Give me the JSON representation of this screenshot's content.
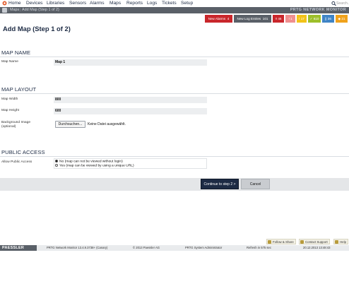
{
  "nav": {
    "items": [
      "Home",
      "Devices",
      "Libraries",
      "Sensors",
      "Alarms",
      "Maps",
      "Reports",
      "Logs",
      "Tickets",
      "Setup"
    ],
    "search_placeholder": "Search..."
  },
  "breadcrumb": {
    "items": [
      "Maps",
      "Add Map (Step 1 of 2)"
    ],
    "brand": "PRTG NETWORK MONITOR"
  },
  "badges": [
    {
      "label": "New Alarms",
      "count": "4",
      "color": "#c9262b"
    },
    {
      "label": "New Log Entries",
      "count": "101",
      "color": "#5a6068"
    },
    {
      "label": "46",
      "color": "#c9262b",
      "icon": "error-icon"
    },
    {
      "label": "1",
      "color": "#ef8f8f",
      "icon": "warning-icon"
    },
    {
      "label": "17",
      "color": "#f2c318",
      "icon": "warning-icon"
    },
    {
      "label": "610",
      "color": "#9dbf2a",
      "icon": "ok-icon"
    },
    {
      "label": "36",
      "color": "#3f84c6",
      "icon": "paused-icon"
    },
    {
      "label": "21",
      "color": "#f0a21c",
      "icon": "unusual-icon"
    }
  ],
  "page": {
    "title": "Add Map (Step 1 of 2)"
  },
  "sections": {
    "map_name": {
      "title": "MAP NAME",
      "label": "Map Name",
      "value": "Map 1"
    },
    "map_layout": {
      "title": "MAP LAYOUT",
      "width_label": "Map Width",
      "width_value": "800",
      "height_label": "Map Height",
      "height_value": "600",
      "bg_label_1": "Background Image",
      "bg_label_2": "(optional)",
      "browse_label": "Durchsuchen...",
      "no_file_label": "Keine Datei ausgewählt."
    },
    "public_access": {
      "title": "PUBLIC ACCESS",
      "label": "Allow Public Access",
      "options": [
        {
          "label": "No (map can not be viewed without login)",
          "selected": true
        },
        {
          "label": "Yes (map can be viewed by using a unique URL)",
          "selected": false
        }
      ]
    }
  },
  "actions": {
    "continue_label": "Continue to step 2 >",
    "cancel_label": "Cancel"
  },
  "help_links": [
    {
      "label": "Follow & Share"
    },
    {
      "label": "Contact Support"
    },
    {
      "label": "Help"
    }
  ],
  "footer": {
    "logo": "PAESSLER",
    "version": "PRTG Network Monitor 13.4.9.3738+ (Canary)",
    "copyright": "© 2013 Paessler AG",
    "user": "PRTG System Administrator",
    "refresh": "Refresh in 575 sec",
    "datetime": "20.12.2013 13:48:43"
  }
}
